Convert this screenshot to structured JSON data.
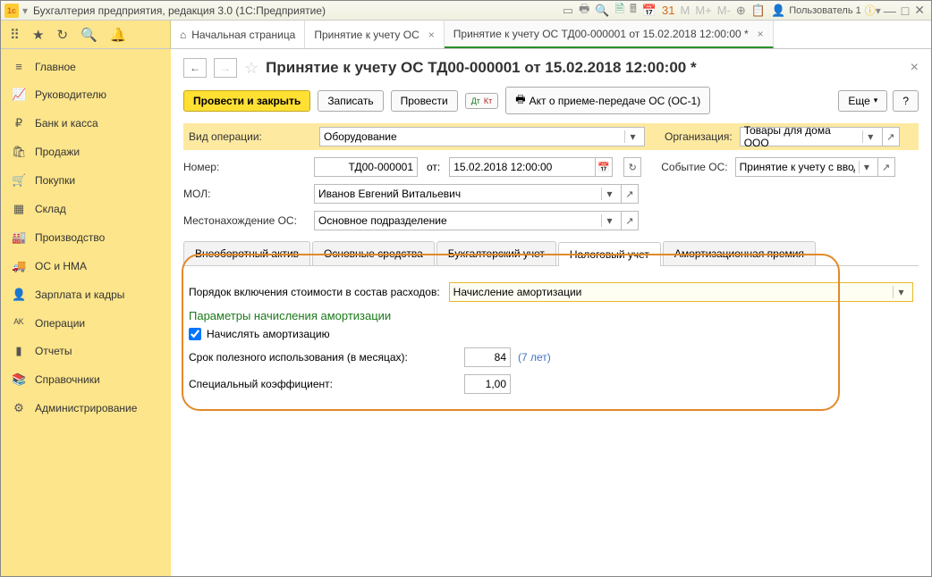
{
  "titlebar": {
    "app_title": "Бухгалтерия предприятия, редакция 3.0  (1С:Предприятие)",
    "user_label": "Пользователь 1"
  },
  "toptabs": {
    "home": "Начальная страница",
    "t1": "Принятие к учету ОС",
    "t2": "Принятие к учету ОС ТД00-000001 от 15.02.2018 12:00:00 *"
  },
  "sidebar": {
    "items": [
      {
        "icon": "≡",
        "label": "Главное"
      },
      {
        "icon": "📈",
        "label": "Руководителю"
      },
      {
        "icon": "₽",
        "label": "Банк и касса"
      },
      {
        "icon": "🛍",
        "label": "Продажи"
      },
      {
        "icon": "🛒",
        "label": "Покупки"
      },
      {
        "icon": "▦",
        "label": "Склад"
      },
      {
        "icon": "🏭",
        "label": "Производство"
      },
      {
        "icon": "🚚",
        "label": "ОС и НМА"
      },
      {
        "icon": "👤",
        "label": "Зарплата и кадры"
      },
      {
        "icon": "ᴬᴷ",
        "label": "Операции"
      },
      {
        "icon": "▮",
        "label": "Отчеты"
      },
      {
        "icon": "📚",
        "label": "Справочники"
      },
      {
        "icon": "⚙",
        "label": "Администрирование"
      }
    ]
  },
  "page": {
    "title": "Принятие к учету ОС ТД00-000001 от 15.02.2018 12:00:00 *"
  },
  "actions": {
    "post_close": "Провести и закрыть",
    "save": "Записать",
    "post": "Провести",
    "akt": "Акт о приеме-передаче ОС (ОС-1)",
    "more": "Еще",
    "help": "?"
  },
  "form": {
    "op_label": "Вид операции:",
    "op_value": "Оборудование",
    "org_label": "Организация:",
    "org_value": "Товары для дома ООО",
    "num_label": "Номер:",
    "num_value": "ТД00-000001",
    "from_label": "от:",
    "date_value": "15.02.2018 12:00:00",
    "event_label": "Событие ОС:",
    "event_value": "Принятие к учету с вводо",
    "mol_label": "МОЛ:",
    "mol_value": "Иванов Евгений Витальевич",
    "loc_label": "Местонахождение ОС:",
    "loc_value": "Основное подразделение"
  },
  "tabs": {
    "t1": "Внеоборотный актив",
    "t2": "Основные средства",
    "t3": "Бухгалтерский учет",
    "t4": "Налоговый учет",
    "t5": "Амортизационная премия"
  },
  "tax": {
    "cost_label": "Порядок включения стоимости в состав расходов:",
    "cost_value": "Начисление амортизации",
    "section": "Параметры начисления амортизации",
    "chk_label": "Начислять амортизацию",
    "life_label": "Срок полезного использования (в месяцах):",
    "life_value": "84",
    "life_hint": "(7 лет)",
    "coef_label": "Специальный коэффициент:",
    "coef_value": "1,00"
  }
}
